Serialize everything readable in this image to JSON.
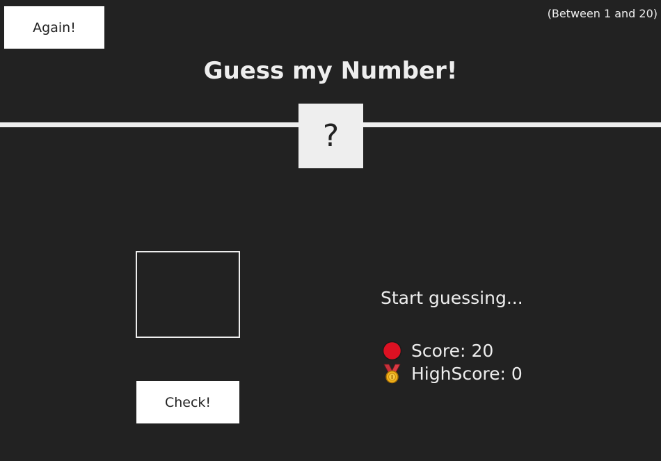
{
  "header": {
    "again_label": "Again!",
    "between_text": "(Between 1 and 20)",
    "title": "Guess my Number!",
    "secret_number": "?"
  },
  "main": {
    "guess_value": "",
    "check_label": "Check!",
    "message": "Start guessing...",
    "score_label": "Score: ",
    "score_value": "20",
    "score_icon": "red-circle-icon",
    "highscore_label": "HighScore: ",
    "highscore_value": "0",
    "highscore_icon": "medal-icon"
  },
  "colors": {
    "background": "#222222",
    "foreground": "#eeeeee",
    "button_bg": "#ffffff",
    "score_icon": "#dd1122",
    "medal_gold": "#f2b31a",
    "medal_ribbon": "#c8303a"
  }
}
